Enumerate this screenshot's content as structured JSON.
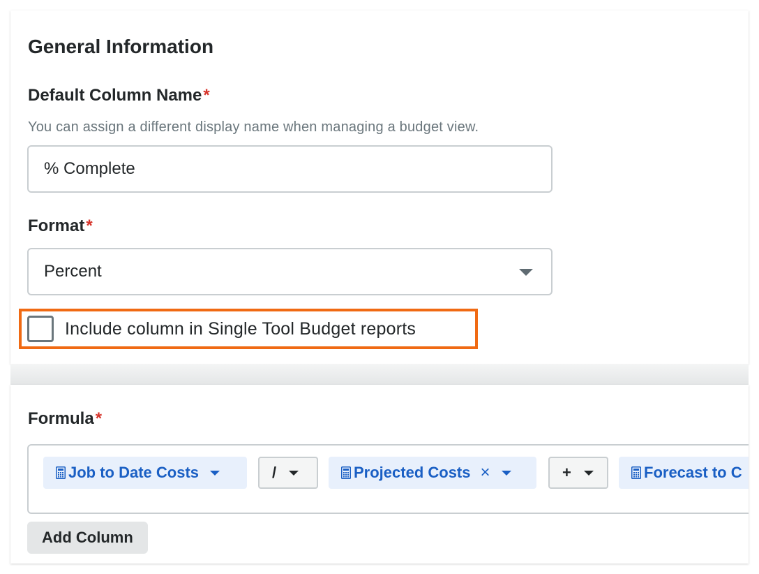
{
  "general": {
    "title": "General Information",
    "column_name": {
      "label": "Default Column Name",
      "required_mark": "*",
      "helper": "You can assign a different display name when managing a budget view.",
      "value": "% Complete"
    },
    "format": {
      "label": "Format",
      "required_mark": "*",
      "selected": "Percent"
    },
    "include_checkbox": {
      "label": "Include column in Single Tool Budget reports",
      "checked": false
    }
  },
  "formula": {
    "label": "Formula",
    "required_mark": "*",
    "tokens": [
      {
        "type": "column",
        "label": "Job to Date Costs"
      },
      {
        "type": "operator",
        "label": "/"
      },
      {
        "type": "column",
        "label": "Projected Costs",
        "removable": true
      },
      {
        "type": "operator",
        "label": "+"
      },
      {
        "type": "column",
        "label": "Forecast to C"
      }
    ],
    "remove_glyph": "×",
    "add_column_label": "Add Column"
  },
  "colors": {
    "highlight": "#f06a13",
    "required": "#d6332a",
    "token_blue": "#1a5fc4",
    "token_bg": "#e8f0fc"
  }
}
